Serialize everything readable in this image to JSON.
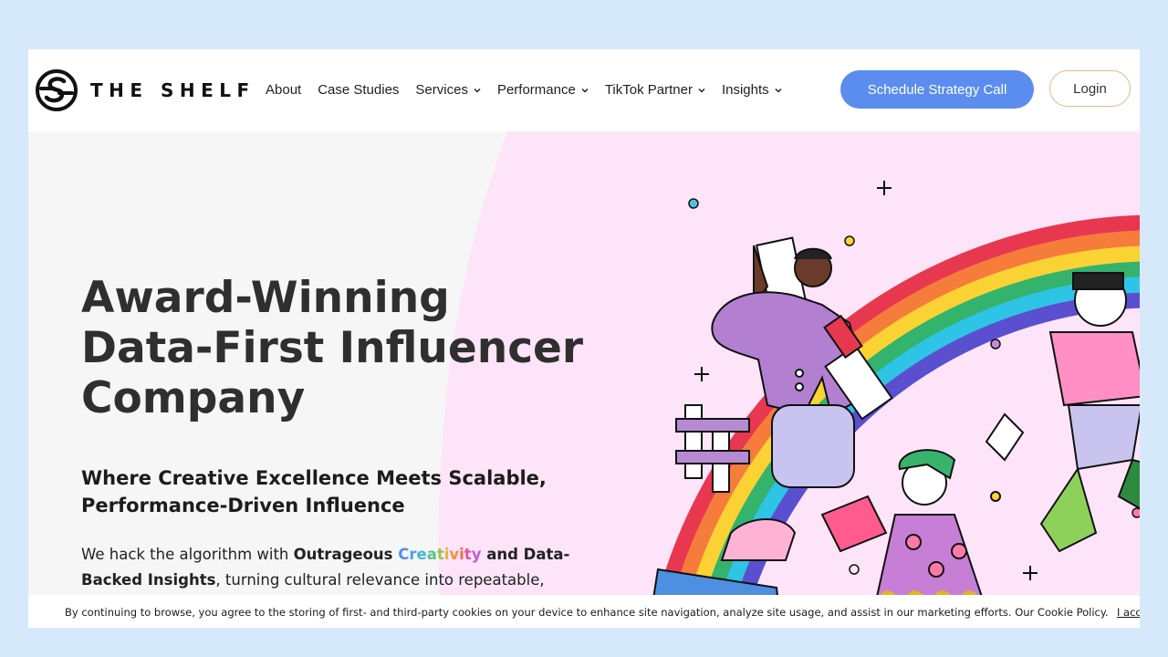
{
  "brand": {
    "name": "THE SHELF"
  },
  "nav": {
    "items": [
      {
        "label": "About",
        "dropdown": false
      },
      {
        "label": "Case Studies",
        "dropdown": false
      },
      {
        "label": "Services",
        "dropdown": true
      },
      {
        "label": "Performance",
        "dropdown": true
      },
      {
        "label": "TikTok Partner",
        "dropdown": true
      },
      {
        "label": "Insights",
        "dropdown": true
      }
    ],
    "cta_label": "Schedule Strategy Call",
    "login_label": "Login"
  },
  "hero": {
    "title_lines": [
      "Award-Winning",
      "Data-First Influencer",
      "Company"
    ],
    "subtitle_lines": [
      "Where Creative Excellence Meets Scalable,",
      "Performance-Driven Influence"
    ],
    "body": {
      "part1": "We hack the algorithm with ",
      "bold1": "Outrageous ",
      "rainbow": "Creativity",
      "bold2": " and Data-",
      "bold3": "Backed Insights",
      "part2": ", turning cultural relevance into repeatable,"
    }
  },
  "cookie": {
    "text": "By continuing to browse, you agree to the storing of first- and third-party cookies on your device to enhance site navigation, analyze site usage, and assist in our marketing efforts. Our Cookie Policy.",
    "accept_label": "I accept"
  },
  "colors": {
    "page_bg": "#d6e9fb",
    "cta_bg": "#5b8def",
    "login_border": "#e4b98c",
    "hero_pink": "#fde4f8",
    "hero_gray": "#f6f6f6"
  }
}
